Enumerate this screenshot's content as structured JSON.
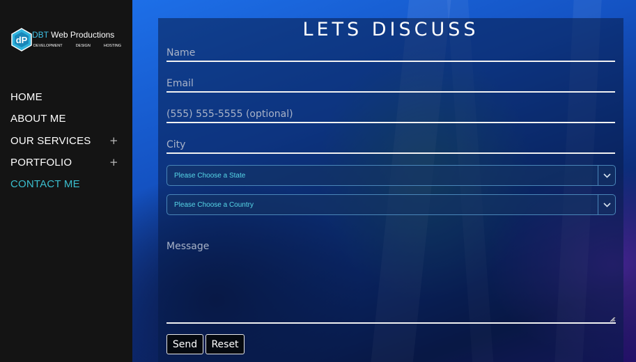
{
  "brand": {
    "initials": "dP",
    "name_accent": "DBT",
    "name_rest": " Web Productions",
    "tags": [
      "DEVELOPMENT",
      "DESIGN",
      "HOSTING"
    ]
  },
  "nav": {
    "items": [
      {
        "label": "HOME"
      },
      {
        "label": "ABOUT ME"
      },
      {
        "label": "OUR SERVICES",
        "expander": "+"
      },
      {
        "label": "PORTFOLIO",
        "expander": "+"
      },
      {
        "label": "CONTACT ME"
      }
    ],
    "active": "CONTACT ME"
  },
  "form": {
    "title": "LETS DISCUSS",
    "name_placeholder": "Name",
    "email_placeholder": "Email",
    "phone_placeholder": "(555) 555-5555 (optional)",
    "city_placeholder": "City",
    "state_value": "Please Choose a State",
    "country_value": "Please Choose a Country",
    "message_placeholder": "Message",
    "send_label": "Send",
    "reset_label": "Reset"
  },
  "icons": {
    "expand": "plus-icon",
    "dropdown": "chevron-down-icon",
    "resize": "resize-grip-icon",
    "logo": "logo-badge-icon"
  },
  "colors": {
    "accent": "#3bbfcf",
    "select_text": "#57d8e8",
    "sidebar_bg": "#141414"
  }
}
